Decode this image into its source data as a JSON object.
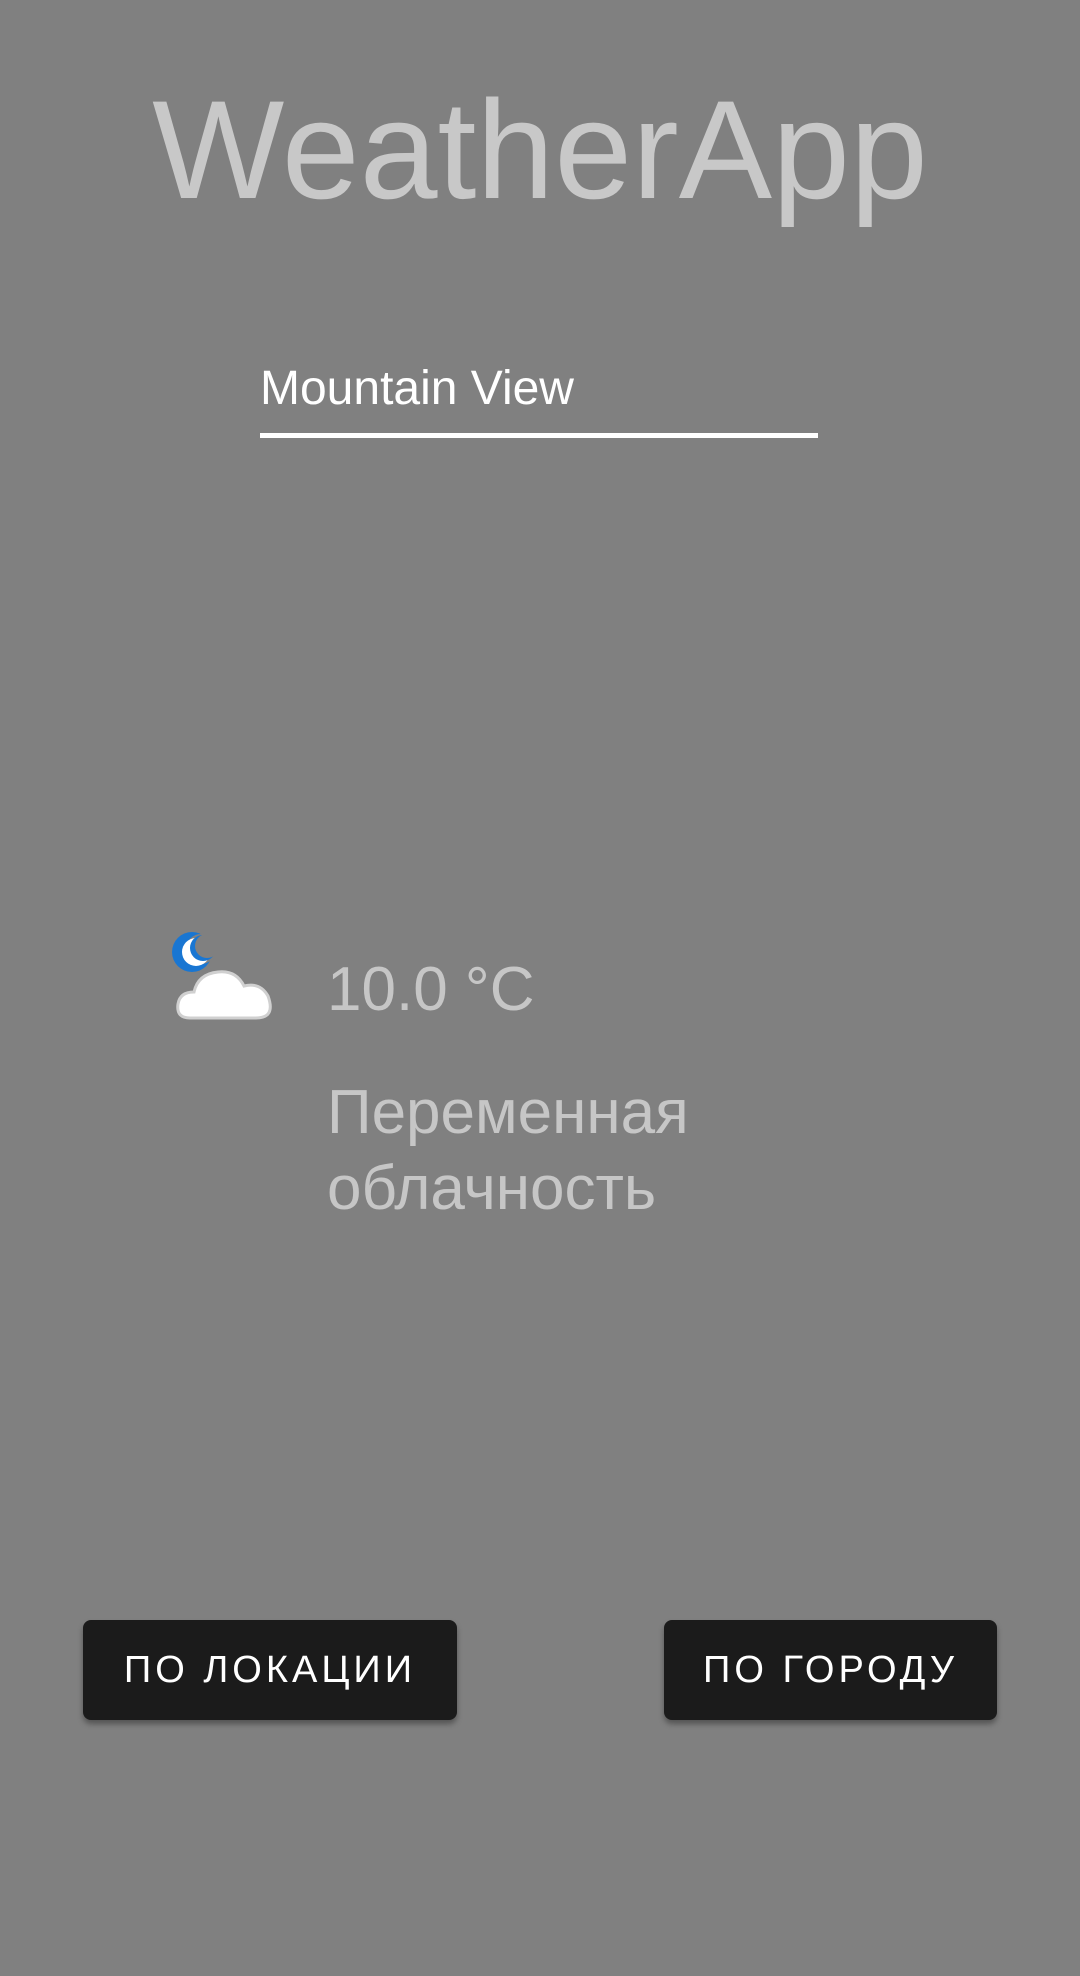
{
  "app": {
    "title": "WeatherApp"
  },
  "city_input": {
    "value": "Mountain View"
  },
  "weather": {
    "icon": "moon-cloud-icon",
    "temperature": "10.0 °C",
    "description": "Переменная облачность"
  },
  "buttons": {
    "by_location": "ПО ЛОКАЦИИ",
    "by_city": "ПО ГОРОДУ"
  },
  "colors": {
    "background": "#808080",
    "button_bg": "#1b1b1b",
    "moon": "#1976d2"
  }
}
